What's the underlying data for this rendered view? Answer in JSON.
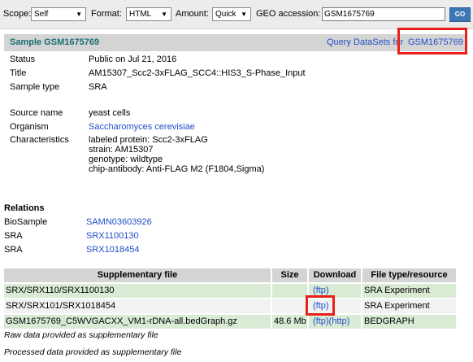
{
  "toolbar": {
    "scope_label": "Scope:",
    "scope_value": "Self",
    "format_label": "Format:",
    "format_value": "HTML",
    "amount_label": "Amount:",
    "amount_value": "Quick",
    "geo_label": "GEO accession:",
    "geo_value": "GSM1675769",
    "go_label": "GO"
  },
  "header": {
    "title": "Sample GSM1675769",
    "query_link": "Query DataSets for",
    "accession_link": "GSM1675769"
  },
  "fields": {
    "status_key": "Status",
    "status_value": "Public on Jul 21, 2016",
    "title_key": "Title",
    "title_value": "AM15307_Scc2-3xFLAG_SCC4::HIS3_S-Phase_Input",
    "sample_type_key": "Sample type",
    "sample_type_value": "SRA",
    "source_key": "Source name",
    "source_value": "yeast cells",
    "organism_key": "Organism",
    "organism_value": "Saccharomyces cerevisiae",
    "characteristics_key": "Characteristics",
    "characteristics": [
      "labeled protein: Scc2-3xFLAG",
      "strain: AM15307",
      "genotype: wildtype",
      "chip-antibody: Anti-FLAG M2 (F1804,Sigma)"
    ]
  },
  "relations": {
    "title": "Relations",
    "items": [
      {
        "key": "BioSample",
        "value": "SAMN03603926"
      },
      {
        "key": "SRA",
        "value": "SRX1100130"
      },
      {
        "key": "SRA",
        "value": "SRX1018454"
      }
    ]
  },
  "supplementary": {
    "headers": [
      "Supplementary file",
      "Size",
      "Download",
      "File type/resource"
    ],
    "rows": [
      {
        "file": "SRX/SRX110/SRX1100130",
        "size": "",
        "download": "(ftp)",
        "type": "SRA Experiment"
      },
      {
        "file": "SRX/SRX101/SRX1018454",
        "size": "",
        "download": "(ftp)",
        "type": "SRA Experiment"
      },
      {
        "file": "GSM1675769_C5WVGACXX_VM1-rDNA-all.bedGraph.gz",
        "size": "48.6 Mb",
        "download": "(ftp)(http)",
        "type": "BEDGRAPH"
      }
    ],
    "note1": "Raw data provided as supplementary file",
    "note2": "Processed data provided as supplementary file"
  },
  "colors": {
    "header_title": "#1a6e73",
    "link": "#1f4ec7",
    "highlight_box": "#e8201a",
    "row_green": "#d9ead5",
    "header_gray": "#d4d4d4"
  }
}
